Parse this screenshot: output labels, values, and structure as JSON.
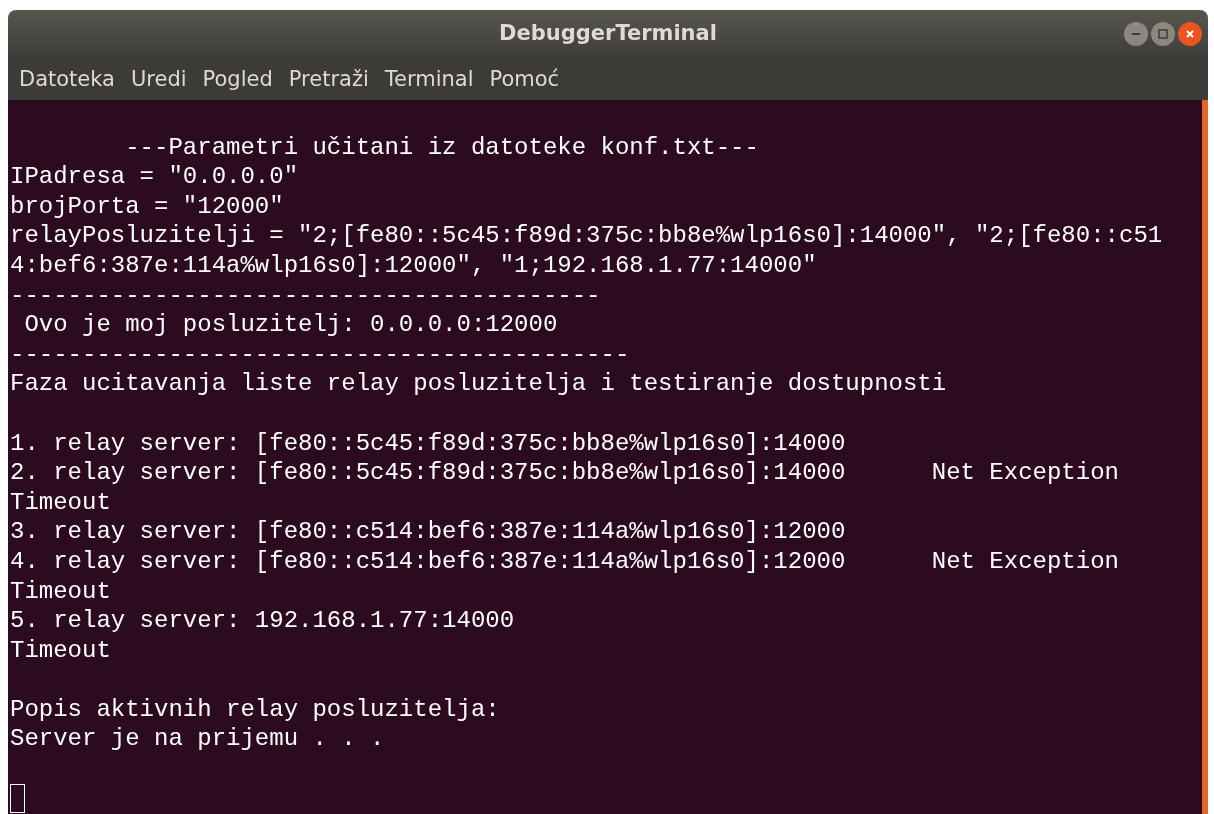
{
  "window": {
    "title": "DebuggerTerminal"
  },
  "menu": {
    "items": [
      "Datoteka",
      "Uredi",
      "Pogled",
      "Pretraži",
      "Terminal",
      "Pomoć"
    ]
  },
  "terminal": {
    "lines": [
      {
        "kind": "blank"
      },
      {
        "kind": "text",
        "text": "        ---Parametri učitani iz datoteke konf.txt---"
      },
      {
        "kind": "text",
        "text": "IPadresa = \"0.0.0.0\""
      },
      {
        "kind": "text",
        "text": "brojPorta = \"12000\""
      },
      {
        "kind": "text",
        "text": "relayPosluzitelji = \"2;[fe80::5c45:f89d:375c:bb8e%wlp16s0]:14000\", \"2;[fe80::c51"
      },
      {
        "kind": "text",
        "text": "4:bef6:387e:114a%wlp16s0]:12000\", \"1;192.168.1.77:14000\""
      },
      {
        "kind": "text",
        "text": "-----------------------------------------"
      },
      {
        "kind": "text",
        "text": " Ovo je moj posluzitelj: 0.0.0.0:12000"
      },
      {
        "kind": "text",
        "text": "-------------------------------------------"
      },
      {
        "kind": "text",
        "text": "Faza ucitavanja liste relay posluzitelja i testiranje dostupnosti"
      },
      {
        "kind": "blank"
      },
      {
        "kind": "text",
        "text": "1. relay server: [fe80::5c45:f89d:375c:bb8e%wlp16s0]:14000"
      },
      {
        "kind": "text",
        "text": "2. relay server: [fe80::5c45:f89d:375c:bb8e%wlp16s0]:14000      Net Exception"
      },
      {
        "kind": "text",
        "text": "Timeout"
      },
      {
        "kind": "text",
        "text": "3. relay server: [fe80::c514:bef6:387e:114a%wlp16s0]:12000"
      },
      {
        "kind": "text",
        "text": "4. relay server: [fe80::c514:bef6:387e:114a%wlp16s0]:12000      Net Exception"
      },
      {
        "kind": "text",
        "text": "Timeout"
      },
      {
        "kind": "text",
        "text": "5. relay server: 192.168.1.77:14000"
      },
      {
        "kind": "text",
        "text": "Timeout"
      },
      {
        "kind": "blank"
      },
      {
        "kind": "text",
        "text": "Popis aktivnih relay posluzitelja:"
      },
      {
        "kind": "text",
        "text": "Server je na prijemu . . ."
      },
      {
        "kind": "blank"
      },
      {
        "kind": "cursor"
      }
    ]
  }
}
